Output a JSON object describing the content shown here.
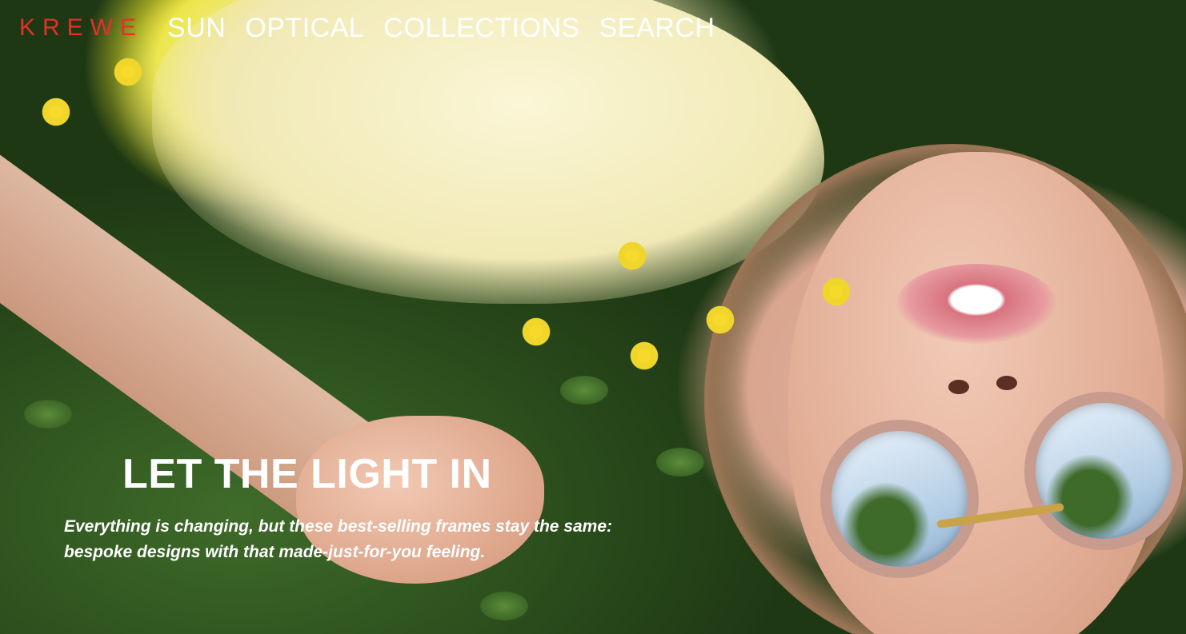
{
  "nav": {
    "brand": "KREWE",
    "links": [
      "SUN",
      "OPTICAL",
      "COLLECTIONS",
      "SEARCH"
    ]
  },
  "hero": {
    "headline": "LET THE LIGHT IN",
    "subcopy": "Everything is changing, but these best-selling frames stay the same: bespoke designs with that made-just-for-you feeling."
  },
  "colors": {
    "brand": "#e3302a",
    "text": "#ffffff"
  }
}
